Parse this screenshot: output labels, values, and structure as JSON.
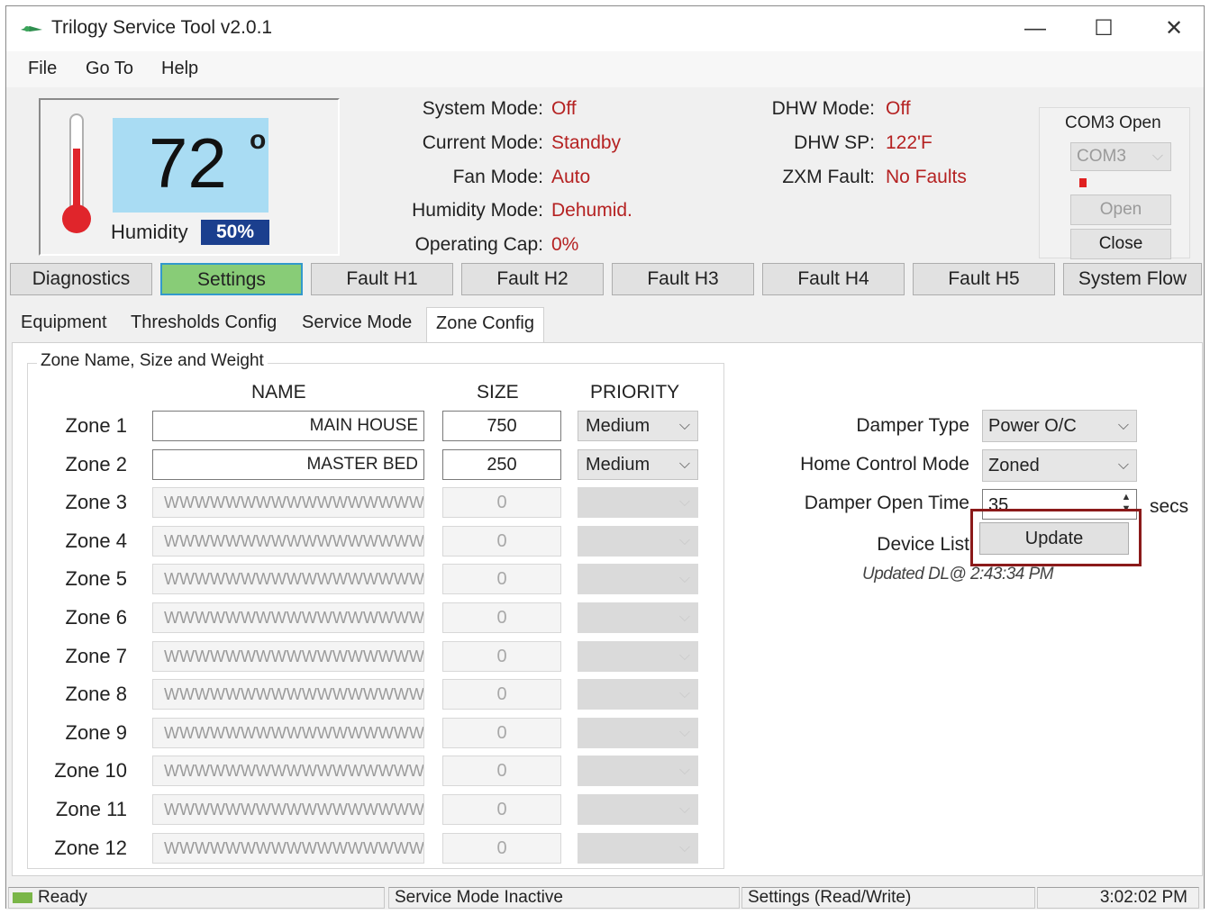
{
  "window": {
    "title": "Trilogy Service Tool  v2.0.1",
    "minimize": "—",
    "maximize": "☐",
    "close": "✕"
  },
  "menu": {
    "file": "File",
    "goto": "Go To",
    "help": "Help"
  },
  "thermostat": {
    "temperature": "72",
    "degree": "o",
    "humidity_label": "Humidity",
    "humidity_value": "50%"
  },
  "status": {
    "system_mode_label": "System Mode:",
    "system_mode": "Off",
    "current_mode_label": "Current Mode:",
    "current_mode": "Standby",
    "fan_mode_label": "Fan Mode:",
    "fan_mode": "Auto",
    "humidity_mode_label": "Humidity Mode:",
    "humidity_mode": "Dehumid.",
    "operating_cap_label": "Operating Cap:",
    "operating_cap": "0%",
    "dhw_mode_label": "DHW Mode:",
    "dhw_mode": "Off",
    "dhw_sp_label": "DHW SP:",
    "dhw_sp": "122'F",
    "zxm_fault_label": "ZXM Fault:",
    "zxm_fault": "No Faults"
  },
  "com": {
    "title": "COM3 Open",
    "port": "COM3",
    "open": "Open",
    "close": "Close"
  },
  "main_tabs": [
    "Diagnostics",
    "Settings",
    "Fault H1",
    "Fault H2",
    "Fault H3",
    "Fault H4",
    "Fault H5",
    "System Flow"
  ],
  "sub_tabs": [
    "Equipment",
    "Thresholds Config",
    "Service Mode",
    "Zone Config"
  ],
  "zone_group": {
    "title": "Zone Name, Size and Weight",
    "col_name": "NAME",
    "col_size": "SIZE",
    "col_priority": "PRIORITY",
    "zones": [
      {
        "label": "Zone 1",
        "name": "MAIN HOUSE",
        "size": "750",
        "priority": "Medium"
      },
      {
        "label": "Zone 2",
        "name": "MASTER BED",
        "size": "250",
        "priority": "Medium"
      },
      {
        "label": "Zone 3",
        "name": "WWWWWWWWWWWWWWWWWWWWWW",
        "size": "0",
        "priority": ""
      },
      {
        "label": "Zone 4",
        "name": "WWWWWWWWWWWWWWWWWWWWWW",
        "size": "0",
        "priority": ""
      },
      {
        "label": "Zone 5",
        "name": "WWWWWWWWWWWWWWWWWWWWWW",
        "size": "0",
        "priority": ""
      },
      {
        "label": "Zone 6",
        "name": "WWWWWWWWWWWWWWWWWWWWWW",
        "size": "0",
        "priority": ""
      },
      {
        "label": "Zone 7",
        "name": "WWWWWWWWWWWWWWWWWWWWWW",
        "size": "0",
        "priority": ""
      },
      {
        "label": "Zone 8",
        "name": "WWWWWWWWWWWWWWWWWWWWWW",
        "size": "0",
        "priority": ""
      },
      {
        "label": "Zone 9",
        "name": "WWWWWWWWWWWWWWWWWWWWWW",
        "size": "0",
        "priority": ""
      },
      {
        "label": "Zone 10",
        "name": "WWWWWWWWWWWWWWWWWWWWWW",
        "size": "0",
        "priority": ""
      },
      {
        "label": "Zone 11",
        "name": "WWWWWWWWWWWWWWWWWWWWWW",
        "size": "0",
        "priority": ""
      },
      {
        "label": "Zone 12",
        "name": "WWWWWWWWWWWWWWWWWWWWWW",
        "size": "0",
        "priority": ""
      }
    ]
  },
  "damper": {
    "type_label": "Damper Type",
    "type_value": "Power O/C",
    "home_control_label": "Home Control  Mode",
    "home_control_value": "Zoned",
    "open_time_label": "Damper Open Time",
    "open_time_value": "35",
    "open_time_unit": "secs",
    "device_list_label": "Device List",
    "update_button": "Update",
    "updated_note": "Updated DL@ 2:43:34 PM"
  },
  "statusbar": {
    "ready": "Ready",
    "service_mode": "Service Mode Inactive",
    "settings": "Settings (Read/Write)",
    "time": "3:02:02 PM"
  }
}
